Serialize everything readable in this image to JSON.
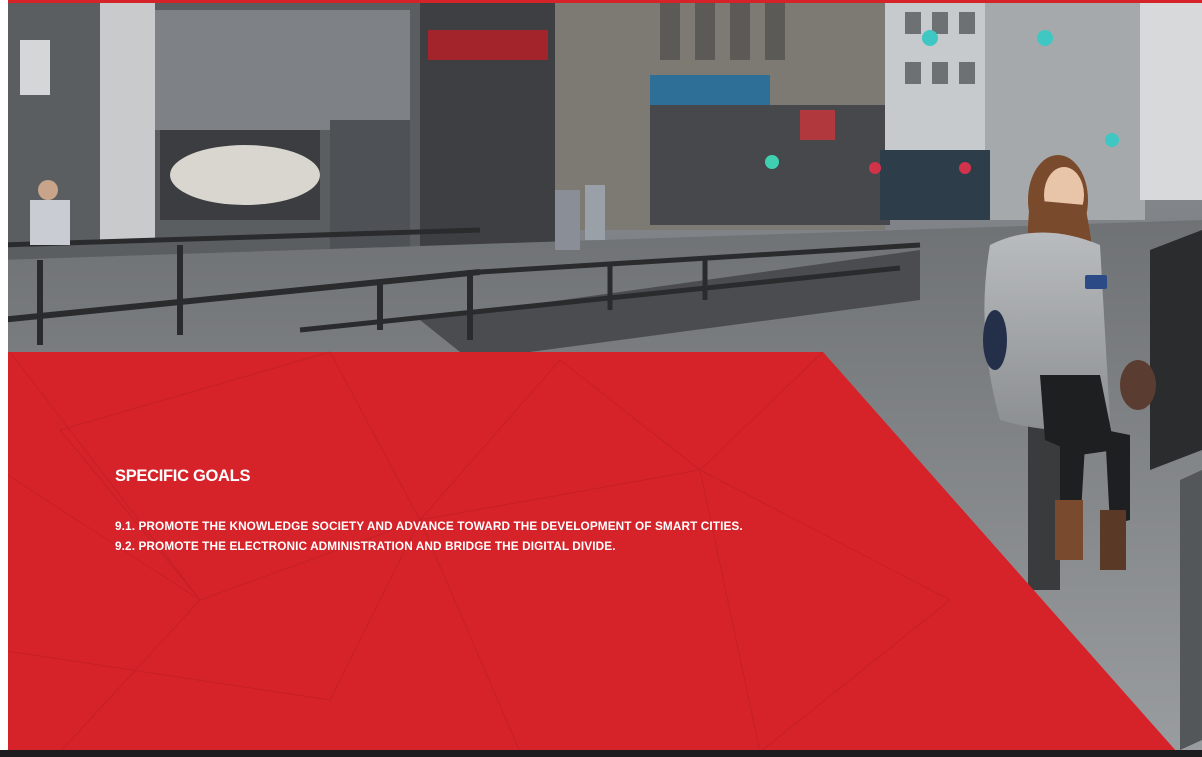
{
  "section": {
    "heading": "SPECIFIC GOALS",
    "goals": [
      {
        "text": "9.1. PROMOTE THE KNOWLEDGE SOCIETY AND ADVANCE TOWARD THE DEVELOPMENT OF SMART CITIES."
      },
      {
        "text": "9.2. PROMOTE THE ELECTRONIC ADMINISTRATION AND BRIDGE THE DIGITAL DIVIDE."
      }
    ]
  },
  "colors": {
    "accent_red": "#d6232a",
    "bottom_bar": "#1d1d1f",
    "text": "#ffffff"
  }
}
